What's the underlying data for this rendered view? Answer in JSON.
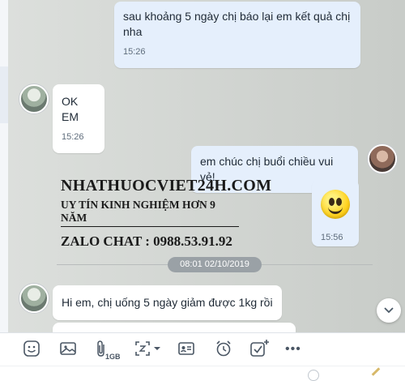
{
  "messages": {
    "m1": {
      "text": "sau khoảng 5 ngày chị báo lại em kết quả chị nha",
      "time": "15:26"
    },
    "m2": {
      "text": "OK EM",
      "time": "15:26"
    },
    "m3": {
      "text": "em chúc chị buổi chiều vui vẻ!"
    },
    "m4": {
      "emoji": "smiley-emoji",
      "time": "15:56"
    },
    "m5": {
      "text": "Hi em, chị uống 5 ngày giảm được 1kg rồi"
    }
  },
  "date_divider": "08:01 02/10/2019",
  "watermark": {
    "line1": "NHATHUOCVIET24H.COM",
    "line2": "UY TÍN KINH NGHIỆM HƠN 9 NĂM",
    "line3": "ZALO CHAT : 0988.53.91.92"
  },
  "toolbar": {
    "file_size_label": "1GB",
    "more_label": "•••"
  }
}
